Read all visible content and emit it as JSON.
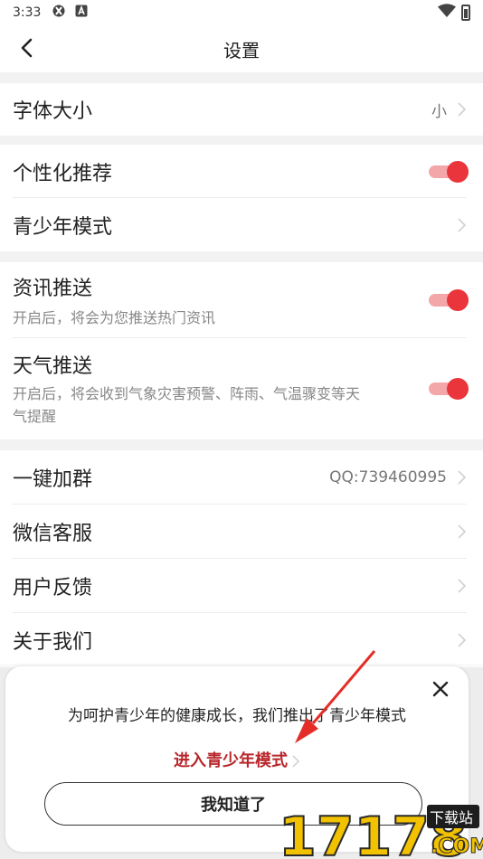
{
  "status_bar": {
    "time": "3:33"
  },
  "header": {
    "title": "设置"
  },
  "settings": {
    "font_size": {
      "label": "字体大小",
      "value": "小"
    },
    "personalized": {
      "label": "个性化推荐",
      "enabled": true
    },
    "youth_mode": {
      "label": "青少年模式"
    },
    "news_push": {
      "label": "资讯推送",
      "desc": "开启后，将会为您推送热门资讯",
      "enabled": true
    },
    "weather_push": {
      "label": "天气推送",
      "desc_line1": "开启后，将会收到气象灾害预警、阵雨、气温骤变等天",
      "desc_line2": "气提醒",
      "enabled": true
    },
    "join_group": {
      "label": "一键加群",
      "value": "QQ:739460995"
    },
    "wechat_service": {
      "label": "微信客服"
    },
    "feedback": {
      "label": "用户反馈"
    },
    "about": {
      "label": "关于我们"
    }
  },
  "dialog": {
    "message": "为呵护青少年的健康成长，我们推出了青少年模式",
    "link": "进入青少年模式",
    "button": "我知道了"
  },
  "watermark": {
    "text": "17178",
    "suffix": "下载站",
    "domain": ".COM"
  },
  "colors": {
    "accent": "#e9353b",
    "link": "#b8262b",
    "toggle_track": "#f3a7a9"
  }
}
